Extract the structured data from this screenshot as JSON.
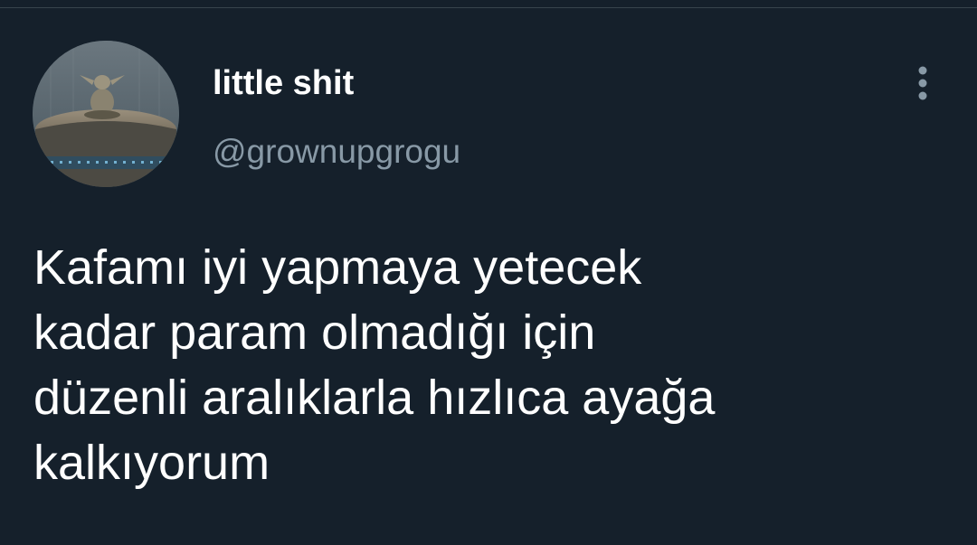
{
  "tweet": {
    "author": {
      "display_name": "little shit",
      "handle": "@grownupgrogu",
      "avatar_icon": "grogu-avatar-icon"
    },
    "menu_icon": "more-vertical-icon",
    "text": "Kafamı iyi yapmaya yetecek\nkadar param olmadığı için\ndüzenli aralıklarla hızlıca ayağa\nkalkıyorum"
  },
  "colors": {
    "background": "#15202b",
    "primary_text": "#ffffff",
    "secondary_text": "#8899a6",
    "divider": "#38444d"
  }
}
